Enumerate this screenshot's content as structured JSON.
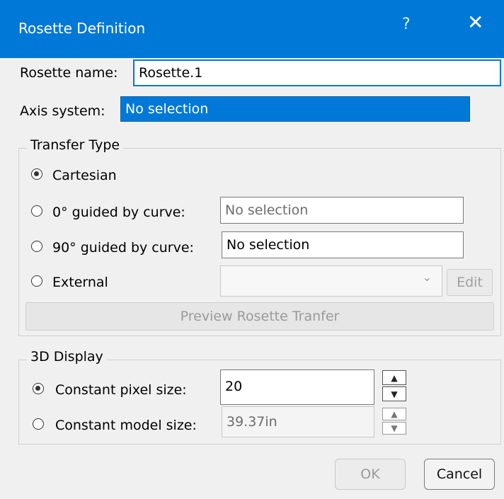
{
  "titlebar": {
    "title": "Rosette Definition",
    "help_glyph": "?",
    "close_glyph": "✕"
  },
  "rosette_name": {
    "label": "Rosette name:",
    "value": "Rosette.1"
  },
  "axis_system": {
    "label": "Axis system:",
    "value": "No selection"
  },
  "transfer_type": {
    "title": "Transfer Type",
    "options": {
      "cartesian": {
        "label": "Cartesian",
        "checked": true
      },
      "guided_0": {
        "label": "0° guided by curve:",
        "value": "No selection"
      },
      "guided_90": {
        "label": "90° guided by curve:",
        "value": "No selection"
      },
      "external": {
        "label": "External",
        "value": "",
        "edit_label": "Edit"
      }
    },
    "preview_label": "Preview Rosette Tranfer"
  },
  "display_3d": {
    "title": "3D Display",
    "pixel": {
      "label": "Constant pixel size:",
      "value": "20",
      "checked": true
    },
    "model": {
      "label": "Constant model size:",
      "value": "39.37in"
    }
  },
  "buttons": {
    "ok": "OK",
    "cancel": "Cancel"
  },
  "icons": {
    "dropdown": "chevron-down-icon",
    "spin_up": "▲",
    "spin_down": "▼"
  },
  "colors": {
    "accent": "#0078d7",
    "background": "#f0f0f0"
  }
}
